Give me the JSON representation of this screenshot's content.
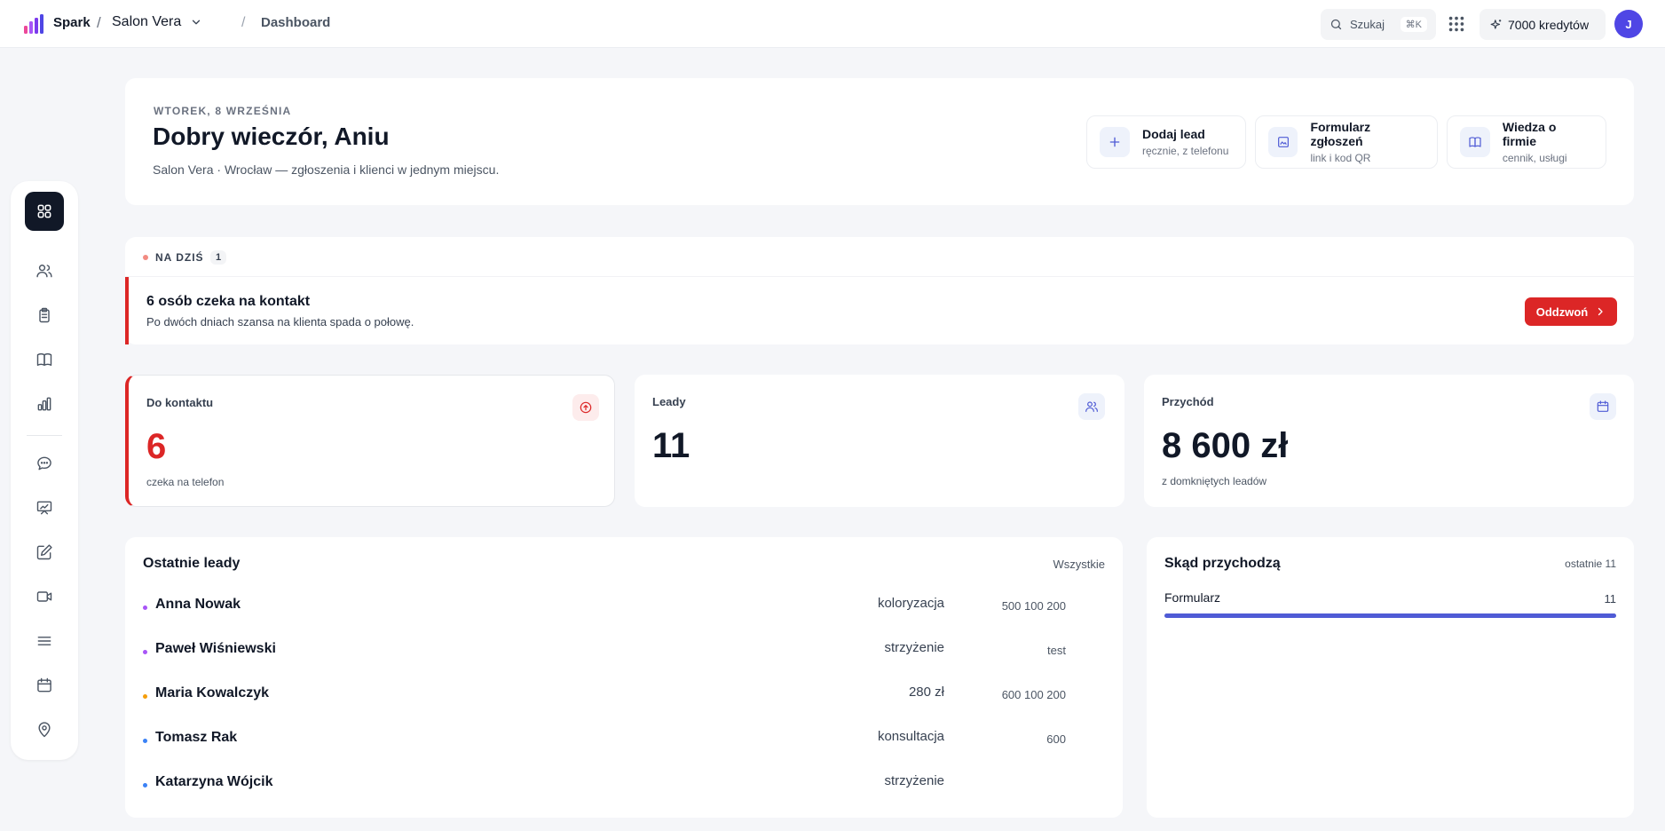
{
  "topbar": {
    "brand": "Spark",
    "separator": "/",
    "workspace": "Salon Vera",
    "breadcrumb_separator": "/",
    "breadcrumb": "Dashboard",
    "search_label": "Szukaj",
    "search_shortcut": "⌘K",
    "credits": "7000 kredytów",
    "avatar_initial": "J",
    "icons": [
      "search-icon",
      "apps-grid-icon",
      "sparkle-icon",
      "chevron-down-icon"
    ]
  },
  "sidebar": {
    "items": [
      {
        "name": "dashboard",
        "icon": "grid-icon",
        "active": true
      },
      {
        "name": "leads",
        "icon": "users-icon"
      },
      {
        "name": "clipboard",
        "icon": "clipboard-icon"
      },
      {
        "name": "knowledge",
        "icon": "book-icon"
      },
      {
        "name": "stats",
        "icon": "bar-chart-icon"
      },
      {
        "name": "messages",
        "icon": "chat-icon"
      },
      {
        "name": "presentation",
        "icon": "presentation-icon"
      },
      {
        "name": "edit",
        "icon": "pencil-icon"
      },
      {
        "name": "video",
        "icon": "video-icon"
      },
      {
        "name": "menu",
        "icon": "menu-icon"
      },
      {
        "name": "calendar",
        "icon": "calendar-icon"
      },
      {
        "name": "location",
        "icon": "map-pin-icon"
      }
    ]
  },
  "hero": {
    "date": "WTOREK, 8 WRZEŚNIA",
    "title": "Dobry wieczór, Aniu",
    "subtitle": "Salon Vera · Wrocław — zgłoszenia i klienci w jednym miejscu.",
    "actions": [
      {
        "title": "Dodaj lead",
        "subtitle": "ręcznie, z telefonu",
        "icon": "plus-icon"
      },
      {
        "title": "Formularz zgłoszeń",
        "subtitle": "link i kod QR",
        "icon": "form-icon"
      },
      {
        "title": "Wiedza o firmie",
        "subtitle": "cennik, usługi",
        "icon": "book-icon"
      }
    ]
  },
  "today": {
    "label": "NA DZIŚ",
    "count": "1",
    "title": "6 osób czeka na kontakt",
    "description": "Po dwóch dniach szansa na klienta spada o połowę.",
    "button": "Oddzwoń"
  },
  "stats": [
    {
      "label": "Do kontaktu",
      "value": "6",
      "sub": "czeka na telefon",
      "icon": "alert-circle-icon",
      "color": "#dc2626"
    },
    {
      "label": "Leady",
      "value": "11",
      "sub": "",
      "icon": "users-icon",
      "color": "#4f5bd5"
    },
    {
      "label": "Przychód",
      "value": "8 600 zł",
      "sub": "z domkniętych leadów",
      "icon": "calendar-icon",
      "color": "#4f5bd5"
    }
  ],
  "leads": {
    "title": "Ostatnie leady",
    "link": "Wszystkie",
    "rows": [
      {
        "name": "Anna Nowak",
        "service": "koloryzacja",
        "phone": "500 100 200",
        "dot_color": "#a855f7"
      },
      {
        "name": "Paweł Wiśniewski",
        "service": "strzyżenie",
        "phone": "test",
        "dot_color": "#a855f7"
      },
      {
        "name": "Maria Kowalczyk",
        "service": "280 zł",
        "phone": "600 100 200",
        "dot_color": "#f59e0b"
      },
      {
        "name": "Tomasz Rak",
        "service": "konsultacja",
        "phone": "600",
        "dot_color": "#3b82f6"
      },
      {
        "name": "Katarzyna Wójcik",
        "service": "strzyżenie",
        "phone": "",
        "dot_color": "#3b82f6"
      }
    ]
  },
  "sources": {
    "title": "Skąd przychodzą",
    "range": "ostatnie 11",
    "rows": [
      {
        "label": "Formularz",
        "value": "11",
        "fraction": 1.0,
        "color": "#4f5bd5"
      }
    ]
  }
}
